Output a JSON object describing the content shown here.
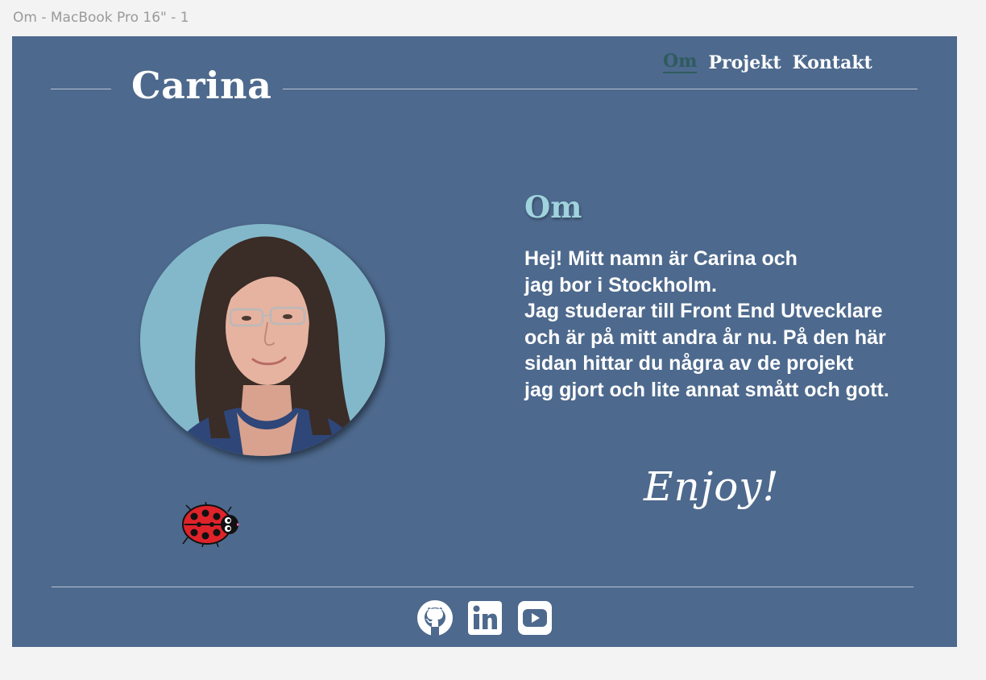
{
  "frame_label": "Om - MacBook Pro 16\" - 1",
  "header": {
    "logo": "Carina",
    "nav": [
      {
        "label": "Om",
        "active": true
      },
      {
        "label": "Projekt",
        "active": false
      },
      {
        "label": "Kontakt",
        "active": false
      }
    ]
  },
  "main": {
    "heading": "Om",
    "text": "Hej! Mitt namn är Carina och\njag bor i Stockholm.\nJag studerar till Front End Utvecklare\noch är på mitt andra år nu. På den här\nsidan hittar du några av de projekt\njag gjort och lite annat smått och gott.",
    "signoff": "Enjoy!"
  },
  "footer": {
    "social_icons": [
      "github-icon",
      "linkedin-icon",
      "youtube-icon"
    ]
  },
  "colors": {
    "background": "#4d698d",
    "heading_accent": "#9fd3de",
    "active_nav": "#2f5b5e",
    "avatar_bg": "#83b8ca"
  }
}
